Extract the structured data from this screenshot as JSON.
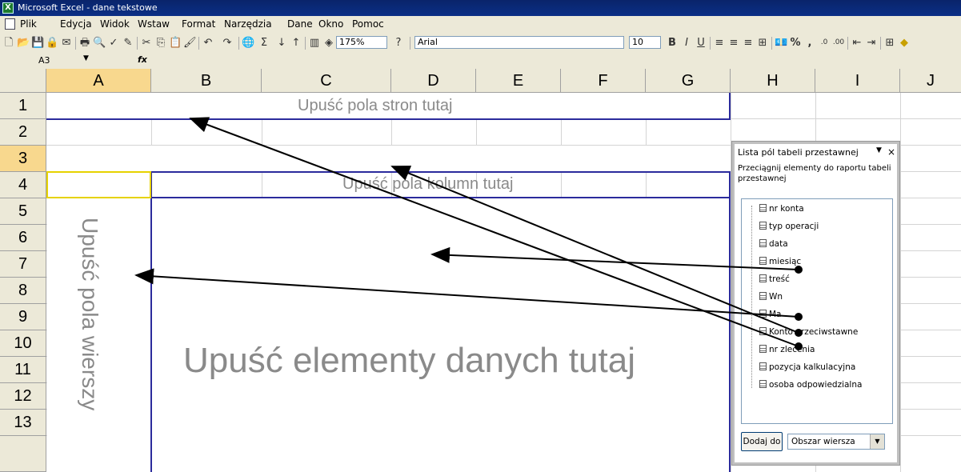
{
  "window": {
    "title": "Microsoft Excel - dane tekstowe",
    "app_icon": "excel-icon"
  },
  "menu": [
    "Plik",
    "Edycja",
    "Widok",
    "Wstaw",
    "Format",
    "Narzędzia",
    "Dane",
    "Okno",
    "Pomoc"
  ],
  "toolbar": {
    "zoom": "175%",
    "font": "Arial",
    "font_size": "10",
    "percent": "%",
    "comma": ","
  },
  "formula_bar": {
    "name_box": "A3",
    "fx": "fx"
  },
  "columns": [
    "A",
    "B",
    "C",
    "D",
    "E",
    "F",
    "G",
    "H",
    "I",
    "J"
  ],
  "rows": [
    "1",
    "2",
    "3",
    "4",
    "5",
    "6",
    "7",
    "8",
    "9",
    "10",
    "11",
    "12",
    "13"
  ],
  "pivot": {
    "page_drop": "Upuść pola stron tutaj",
    "column_drop": "Upuść pola kolumn tutaj",
    "row_drop": "Upuść pola wierszy",
    "data_drop": "Upuść elementy danych tutaj"
  },
  "field_list": {
    "title": "Lista pól tabeli przestawnej",
    "description": "Przeciągnij elementy do raportu tabeli przestawnej",
    "fields": [
      "nr konta",
      "typ operacji",
      "data",
      "miesiąc",
      "treść",
      "Wn",
      "Ma",
      "Konto przeciwstawne",
      "nr zlecenia",
      "pozycja kalkulacyjna",
      "osoba odpowiedzialna"
    ],
    "add_button": "Dodaj do",
    "area_select": "Obszar wiersza"
  },
  "colors": {
    "selection": "#f8d88e",
    "pivot_border": "#2b2b9c",
    "dropzone_text": "#8a8a8a"
  }
}
